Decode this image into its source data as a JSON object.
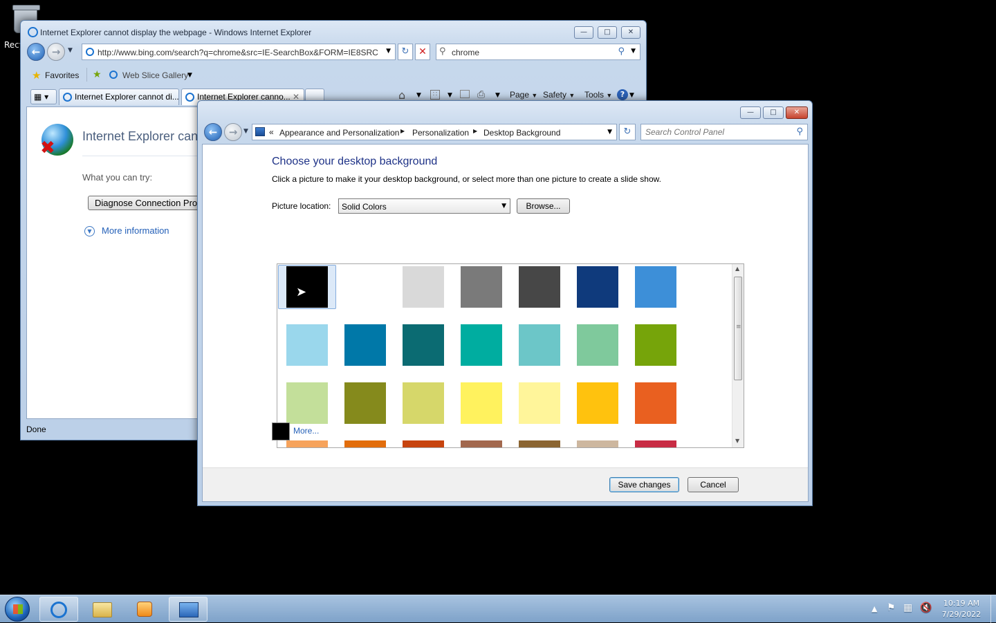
{
  "desktop": {
    "recycle_label": "Recy"
  },
  "ie": {
    "title": "Internet Explorer cannot display the webpage - Windows Internet Explorer",
    "address": "http://www.bing.com/search?q=chrome&src=IE-SearchBox&FORM=IE8SRC",
    "search_value": "chrome",
    "favorites_label": "Favorites",
    "web_slice_label": "Web Slice Gallery",
    "tabs": [
      {
        "label": "Internet Explorer cannot di..."
      },
      {
        "label": "Internet Explorer canno..."
      }
    ],
    "commands": {
      "page": "Page",
      "safety": "Safety",
      "tools": "Tools"
    },
    "content": {
      "heading": "Internet Explorer cann",
      "what_you_can_try": "What you can try:",
      "diagnose_button": "Diagnose Connection Pro",
      "more_info": "More information"
    },
    "status": "Done"
  },
  "cp": {
    "breadcrumb": [
      "Appearance and Personalization",
      "Personalization",
      "Desktop Background"
    ],
    "search_placeholder": "Search Control Panel",
    "heading": "Choose your desktop background",
    "description": "Click a picture to make it your desktop background, or select more than one picture to create a slide show.",
    "picture_location_label": "Picture location:",
    "picture_location_value": "Solid Colors",
    "browse_label": "Browse...",
    "swatches": [
      [
        "#000000",
        "#ffffff",
        "#d9d9d9",
        "#7a7a7a",
        "#474747",
        "#0f3a7c",
        "#3d8fd8"
      ],
      [
        "#9ad7ec",
        "#0078a8",
        "#0b6b72",
        "#00ada0",
        "#6cc6c8",
        "#7fc99c",
        "#76a40a"
      ],
      [
        "#c3df9a",
        "#858a1c",
        "#d6d76a",
        "#fff25e",
        "#fff59a",
        "#ffc20e",
        "#e96020"
      ],
      [
        "#f6a35c",
        "#e26d0c",
        "#c7440f",
        "#a2684e",
        "#8b6532",
        "#cdb79f",
        "#c82c44"
      ]
    ],
    "more_label": "More...",
    "more_color": "#000000",
    "save_label": "Save changes",
    "cancel_label": "Cancel"
  },
  "taskbar": {
    "time": "10:19 AM",
    "date": "7/29/2022"
  }
}
